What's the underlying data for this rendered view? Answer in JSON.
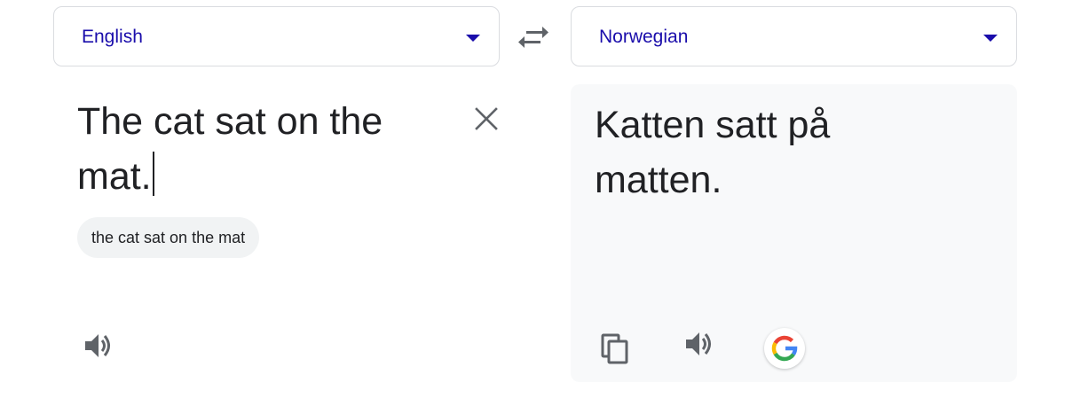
{
  "source": {
    "language": "English",
    "text": "The cat sat on the mat.",
    "suggestion": "the cat sat on the mat"
  },
  "target": {
    "language": "Norwegian",
    "text": "Katten satt på matten."
  },
  "icons": {
    "dropdown": "chevron-down-icon",
    "swap": "swap-arrows-icon",
    "clear": "close-icon",
    "listen": "speaker-icon",
    "copy": "copy-icon",
    "google": "google-g-icon"
  },
  "colors": {
    "language_label": "#1a0dab",
    "icon_gray": "#5f6368",
    "target_panel_bg": "#f8f9fa",
    "chip_bg": "#f1f3f4",
    "google_blue": "#4285f4",
    "google_red": "#ea4335",
    "google_yellow": "#fbbc05",
    "google_green": "#34a853"
  }
}
